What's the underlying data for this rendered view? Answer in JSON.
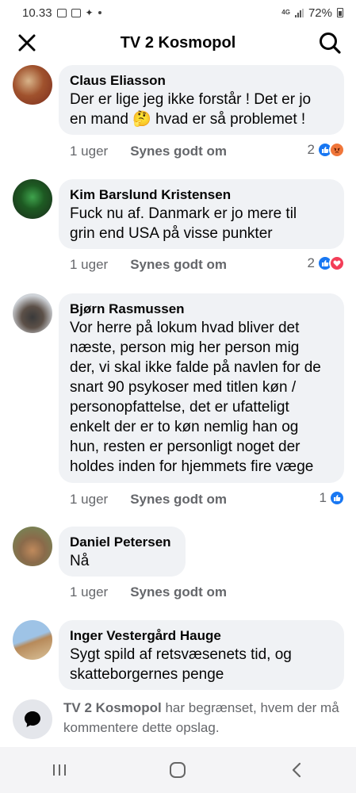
{
  "status_bar": {
    "time": "10.33",
    "network": "4G",
    "battery": "72%"
  },
  "header": {
    "title": "TV 2 Kosmopol"
  },
  "comments": [
    {
      "author": "Claus Eliasson",
      "text": "Der er lige jeg ikke forstår ! Det er jo\nen mand 🤔 hvad er så problemet !",
      "time": "1 uger",
      "like_label": "Synes godt om",
      "reaction_count": "2",
      "reactions": [
        "like",
        "angry"
      ],
      "avatar_colors": [
        "#7a2c1e",
        "#d8b48a"
      ]
    },
    {
      "author": "Kim Barslund Kristensen",
      "text": "Fuck nu af. Danmark er jo mere til\ngrin end USA på visse punkter",
      "time": "1 uger",
      "like_label": "Synes godt om",
      "reaction_count": "2",
      "reactions": [
        "like",
        "love"
      ],
      "avatar_colors": [
        "#1c2b1c",
        "#3fa34d"
      ]
    },
    {
      "author": "Bjørn Rasmussen",
      "text": "Vor herre på lokum hvad bliver det\nnæste, person mig her person mig\nder, vi skal ikke falde på navlen for de\nsnart 90 psykoser med titlen køn /\npersonopfattelse, det er ufatteligt\nenkelt der er to køn nemlig han og\nhun, resten er personligt noget der\nholdes inden for hjemmets fire væge",
      "time": "1 uger",
      "like_label": "Synes godt om",
      "reaction_count": "1",
      "reactions": [
        "like"
      ],
      "avatar_colors": [
        "#cfd3d8",
        "#3a3a3a"
      ]
    },
    {
      "author": "Daniel Petersen",
      "text": "Nå",
      "time": "1 uger",
      "like_label": "Synes godt om",
      "reaction_count": "",
      "reactions": [],
      "avatar_colors": [
        "#6f8f5a",
        "#c08a5c"
      ]
    },
    {
      "author": "Inger Vestergård Hauge",
      "text": "Sygt spild af retsvæsenets tid, og\nskatteborgernes penge",
      "time": "",
      "like_label": "",
      "reaction_count": "",
      "reactions": [],
      "avatar_colors": [
        "#9ec3e6",
        "#b78a5a"
      ]
    }
  ],
  "restriction": {
    "page_name": "TV 2 Kosmopol",
    "message": " har begrænset, hvem der må kommentere dette opslag."
  },
  "colors": {
    "bubble": "#f0f2f5",
    "meta_text": "#65676b",
    "like_blue": "#1877f2",
    "love_red": "#f33e58",
    "angry_orange": "#f0763a"
  }
}
